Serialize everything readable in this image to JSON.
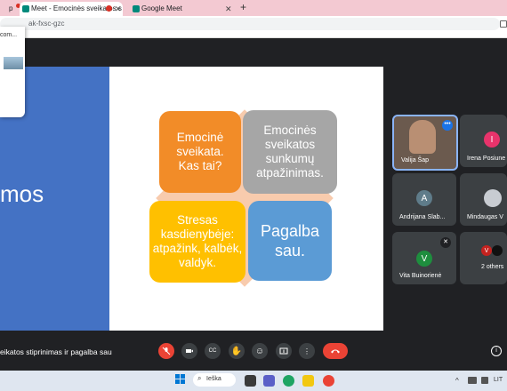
{
  "tabs": [
    {
      "title": "p"
    },
    {
      "title": "Meet - Emocinės sveikatos s"
    },
    {
      "title": "Google Meet"
    }
  ],
  "new_tab_label": "+",
  "url": "ak-fxsc-gzc",
  "dropdown_text": "com...",
  "slide": {
    "left_title_fragment": "mos",
    "boxes": [
      {
        "text": "Emocinė sveikata. Kas tai?",
        "color": "#f28c28"
      },
      {
        "text": "Emocinės sveikatos sunkumų atpažinimas.",
        "color": "#a6a6a6"
      },
      {
        "text": "Stresas kasdienybėje: atpažink, kalbėk, valdyk.",
        "color": "#ffc000"
      },
      {
        "text": "Pagalba sau.",
        "color": "#5b9bd5"
      }
    ],
    "diamond_color": "#f8cbad"
  },
  "participants": [
    {
      "name": "Valija Šap"
    },
    {
      "name": "Irena Posiune",
      "initial": "I",
      "color": "#e8336b"
    },
    {
      "name": "Andrijana Slab...",
      "initial": "A",
      "color": "#5f7c8a"
    },
    {
      "name": "Mindaugas V"
    },
    {
      "name": "Vita Buinorienė",
      "initial": "V",
      "color": "#1e8e3e"
    },
    {
      "name": "2 others",
      "initial": "V",
      "color": "#c5221f"
    }
  ],
  "meeting_title": "eikatos stiprinimas ir pagalba sau",
  "controls": {
    "cc": "CC",
    "info": "i"
  },
  "taskbar": {
    "search_placeholder": "Ieška",
    "lang": "LIT"
  }
}
